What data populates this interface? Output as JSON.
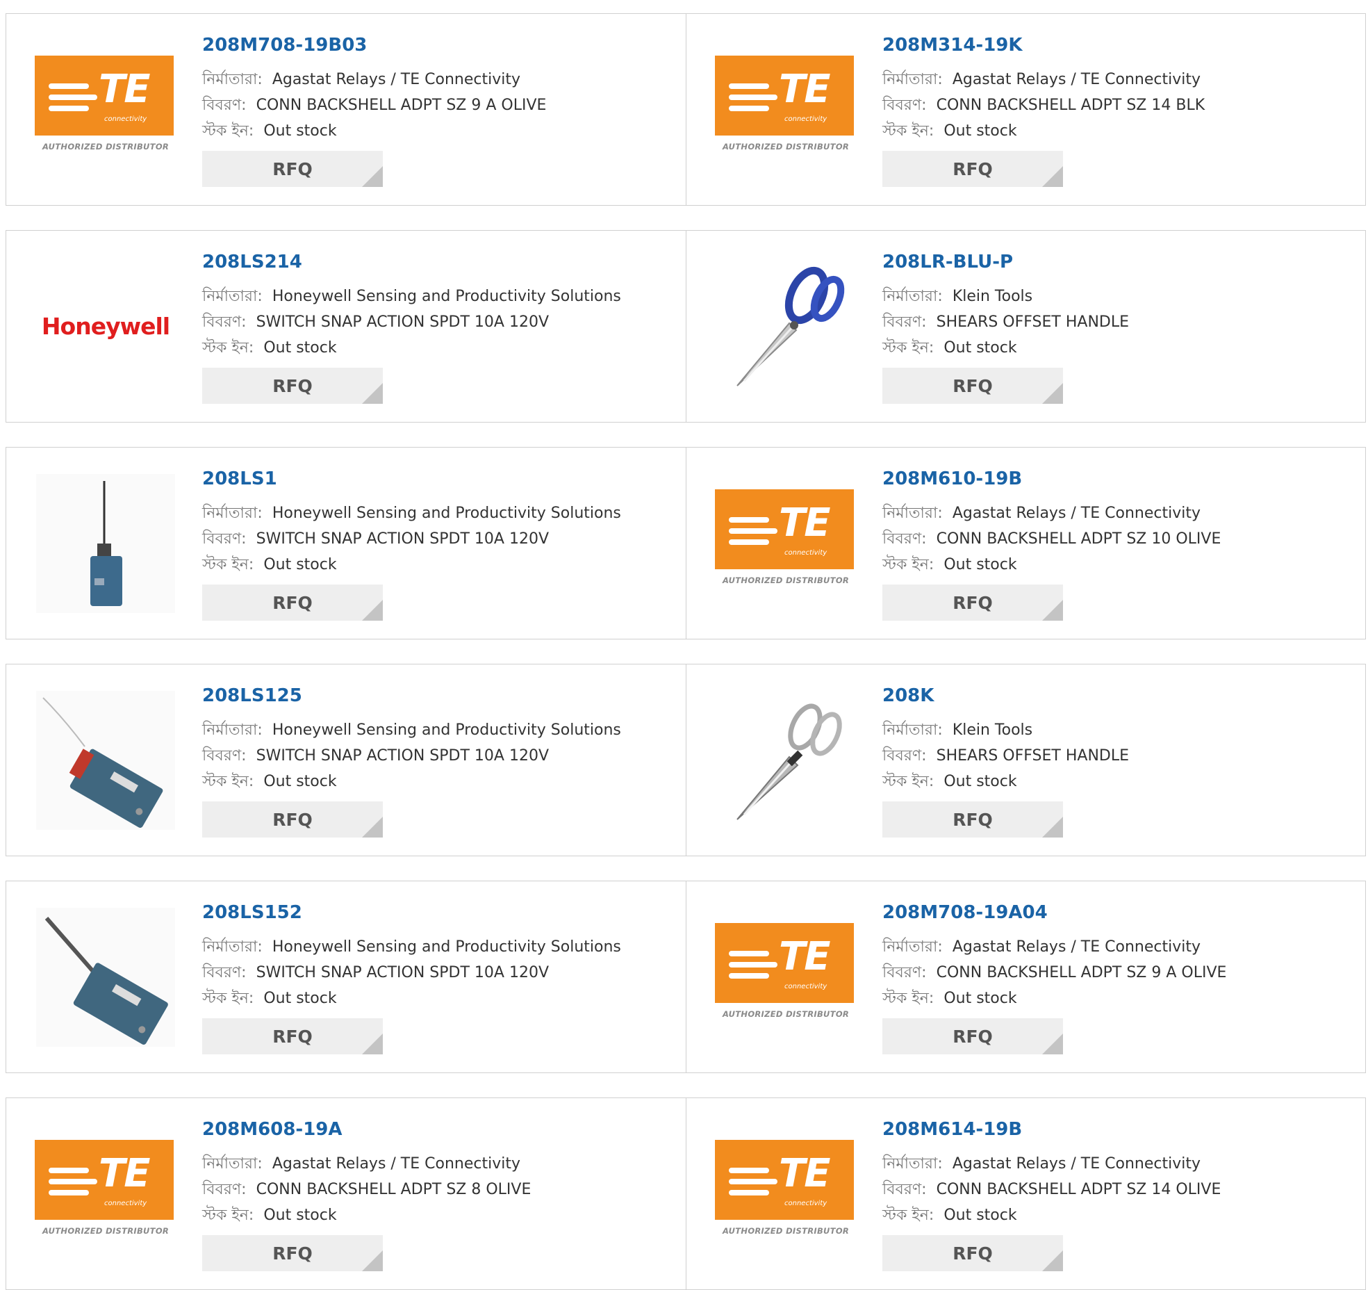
{
  "labels": {
    "manufacturer": "নির্মাতারা:",
    "description": "বিবরণ:",
    "stock": "স্টক ইন:"
  },
  "products": [
    {
      "part": "208M708-19B03",
      "manufacturer": "Agastat Relays / TE Connectivity",
      "description": "CONN BACKSHELL ADPT SZ 9 A OLIVE",
      "stock": "Out stock",
      "rfq": "RFQ",
      "image": "te-logo"
    },
    {
      "part": "208M314-19K",
      "manufacturer": "Agastat Relays / TE Connectivity",
      "description": "CONN BACKSHELL ADPT SZ 14 BLK",
      "stock": "Out stock",
      "rfq": "RFQ",
      "image": "te-logo"
    },
    {
      "part": "208LS214",
      "manufacturer": "Honeywell Sensing and Productivity Solutions",
      "description": "SWITCH SNAP ACTION SPDT 10A 120V",
      "stock": "Out stock",
      "rfq": "RFQ",
      "image": "honeywell-logo"
    },
    {
      "part": "208LR-BLU-P",
      "manufacturer": "Klein Tools",
      "description": "SHEARS OFFSET HANDLE",
      "stock": "Out stock",
      "rfq": "RFQ",
      "image": "blue-shears-photo"
    },
    {
      "part": "208LS1",
      "manufacturer": "Honeywell Sensing and Productivity Solutions",
      "description": "SWITCH SNAP ACTION SPDT 10A 120V",
      "stock": "Out stock",
      "rfq": "RFQ",
      "image": "limit-switch-rod-photo"
    },
    {
      "part": "208M610-19B",
      "manufacturer": "Agastat Relays / TE Connectivity",
      "description": "CONN BACKSHELL ADPT SZ 10 OLIVE",
      "stock": "Out stock",
      "rfq": "RFQ",
      "image": "te-logo"
    },
    {
      "part": "208LS125",
      "manufacturer": "Honeywell Sensing and Productivity Solutions",
      "description": "SWITCH SNAP ACTION SPDT 10A 120V",
      "stock": "Out stock",
      "rfq": "RFQ",
      "image": "limit-switch-wire-photo"
    },
    {
      "part": "208K",
      "manufacturer": "Klein Tools",
      "description": "SHEARS OFFSET HANDLE",
      "stock": "Out stock",
      "rfq": "RFQ",
      "image": "chrome-shears-photo"
    },
    {
      "part": "208LS152",
      "manufacturer": "Honeywell Sensing and Productivity Solutions",
      "description": "SWITCH SNAP ACTION SPDT 10A 120V",
      "stock": "Out stock",
      "rfq": "RFQ",
      "image": "limit-switch-lever-photo"
    },
    {
      "part": "208M708-19A04",
      "manufacturer": "Agastat Relays / TE Connectivity",
      "description": "CONN BACKSHELL ADPT SZ 9 A OLIVE",
      "stock": "Out stock",
      "rfq": "RFQ",
      "image": "te-logo"
    },
    {
      "part": "208M608-19A",
      "manufacturer": "Agastat Relays / TE Connectivity",
      "description": "CONN BACKSHELL ADPT SZ 8 OLIVE",
      "stock": "Out stock",
      "rfq": "RFQ",
      "image": "te-logo"
    },
    {
      "part": "208M614-19B",
      "manufacturer": "Agastat Relays / TE Connectivity",
      "description": "CONN BACKSHELL ADPT SZ 14 OLIVE",
      "stock": "Out stock",
      "rfq": "RFQ",
      "image": "te-logo"
    }
  ],
  "logos": {
    "te_text": "TE",
    "te_sub": "connectivity",
    "te_distributor": "AUTHORIZED DISTRIBUTOR",
    "honeywell": "Honeywell"
  },
  "colors": {
    "part_link": "#1a63a6",
    "te_orange": "#f28c1e",
    "honeywell_red": "#e01e1e",
    "rfq_bg": "#eeeeee"
  }
}
